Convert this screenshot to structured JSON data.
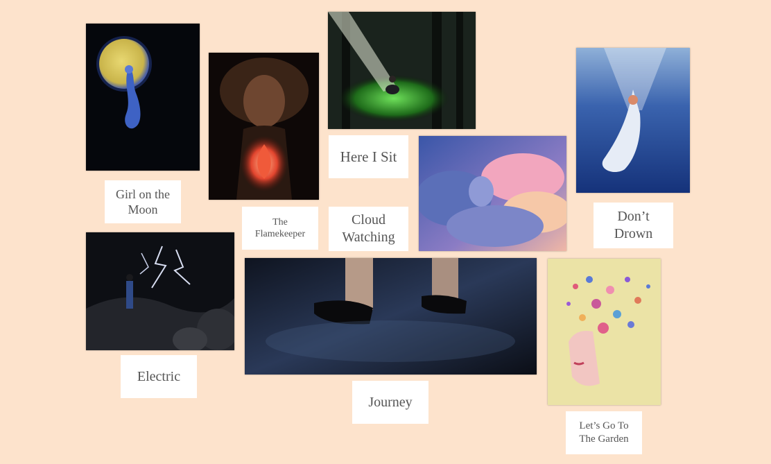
{
  "artworks": [
    {
      "id": "moon",
      "title": "Girl on the\nMoon"
    },
    {
      "id": "flame",
      "title": "The\nFlamekeeper"
    },
    {
      "id": "sit",
      "title": "Here I Sit"
    },
    {
      "id": "cloud",
      "title": "Cloud\nWatching"
    },
    {
      "id": "drown",
      "title": "Don’t\nDrown"
    },
    {
      "id": "electric",
      "title": "Electric"
    },
    {
      "id": "journey",
      "title": "Journey"
    },
    {
      "id": "garden",
      "title": "Let’s Go To\nThe Garden"
    }
  ]
}
